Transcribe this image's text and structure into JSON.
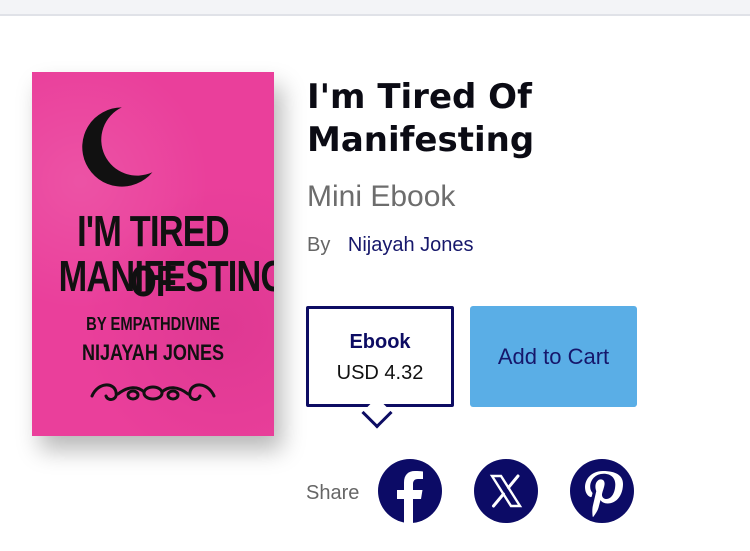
{
  "book": {
    "title": "I'm Tired Of Manifesting",
    "subtitle": "Mini Ebook",
    "by_label": "By",
    "author": "Nijayah Jones",
    "cover": {
      "line1": "I'M TIRED OF",
      "line2": "MANIFESTING",
      "by_line": "BY EMPATHDIVINE",
      "author_line": "NIJAYAH JONES",
      "background_color": "#ea3f9b"
    }
  },
  "purchase": {
    "format_name": "Ebook",
    "price": "USD 4.32",
    "add_to_cart_label": "Add to Cart",
    "accent_color": "#0d0c63",
    "button_color": "#5aaee6"
  },
  "share": {
    "label": "Share",
    "icons": [
      "facebook-icon",
      "x-icon",
      "pinterest-icon"
    ]
  }
}
